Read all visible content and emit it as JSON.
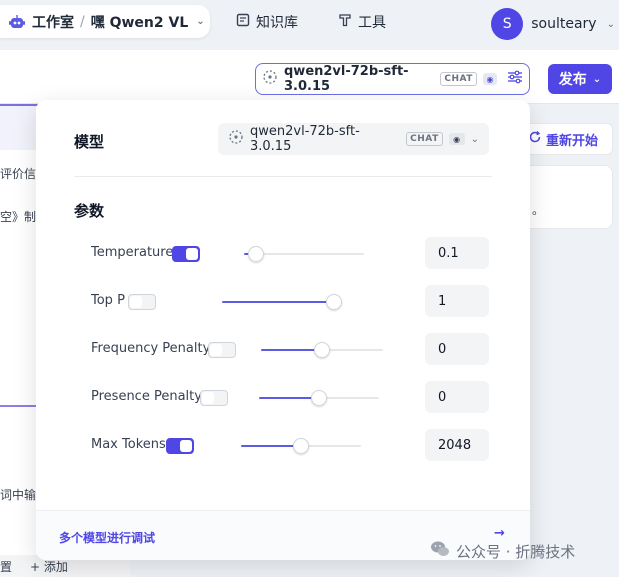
{
  "header": {
    "workspace": "工作室",
    "separator": "/",
    "app_name": "嘿 Qwen2 VL",
    "nav": [
      {
        "label": "知识库",
        "icon": "book-icon"
      },
      {
        "label": "工具",
        "icon": "tool-icon"
      }
    ],
    "user": {
      "avatar_letter": "S",
      "name": "soulteary"
    }
  },
  "toolbar": {
    "model": "qwen2vl-72b-sft-3.0.15",
    "model_tag": "CHAT",
    "publish_label": "发布",
    "restart_label": "重新开始"
  },
  "background": {
    "left_text_1": "评价信",
    "left_text_2": "空》制",
    "left_text_3": "词中输",
    "left_bottom_text": "设置",
    "add_label": "+ 添加",
    "right_card_text": "。"
  },
  "panel": {
    "model_heading": "模型",
    "model_value": "qwen2vl-72b-sft-3.0.15",
    "model_tag": "CHAT",
    "params_heading": "参数",
    "params": [
      {
        "label": "Temperature",
        "enabled": true,
        "value": "0.1",
        "fraction": 0.1
      },
      {
        "label": "Top P",
        "enabled": false,
        "value": "1",
        "fraction": 1.0
      },
      {
        "label": "Frequency Penalty",
        "enabled": false,
        "value": "0",
        "fraction": 0.5
      },
      {
        "label": "Presence Penalty",
        "enabled": false,
        "value": "0",
        "fraction": 0.5
      },
      {
        "label": "Max Tokens",
        "enabled": true,
        "value": "2048",
        "fraction": 0.5
      }
    ],
    "footer_link": "多个模型进行调试",
    "footer_arrow": "→"
  },
  "watermark": "公众号 · 折腾技术",
  "colors": {
    "accent": "#4f46e5",
    "page_bg": "#eef1f6"
  }
}
